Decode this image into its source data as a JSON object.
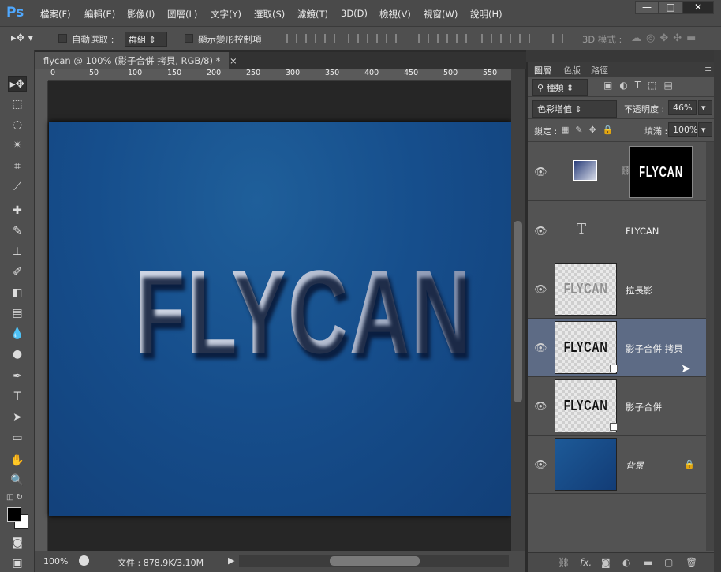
{
  "app": {
    "logo": "Ps"
  },
  "menu": [
    "檔案(F)",
    "編輯(E)",
    "影像(I)",
    "圖層(L)",
    "文字(Y)",
    "選取(S)",
    "濾鏡(T)",
    "3D(D)",
    "檢視(V)",
    "視窗(W)",
    "說明(H)"
  ],
  "window_controls": {
    "minimize": "—",
    "maximize": "□",
    "close": "✕"
  },
  "options": {
    "auto_select_label": "自動選取 :",
    "auto_select_value": "群組",
    "show_transform_label": "顯示變形控制項",
    "mode_3d_label": "3D 模式 :"
  },
  "document": {
    "tab_title": "flycan @ 100% (影子合併 拷貝, RGB/8) *",
    "tab_close": "×",
    "canvas_text": "FLYCAN",
    "ruler_ticks": [
      "0",
      "50",
      "100",
      "150",
      "200",
      "250",
      "300",
      "350",
      "400",
      "450",
      "500",
      "550"
    ]
  },
  "status": {
    "zoom": "100%",
    "doc_info": "文件 : 878.9K/3.10M"
  },
  "layers_panel": {
    "tabs": [
      "圖層",
      "色版",
      "路徑"
    ],
    "filter_kind": "種類",
    "blend_mode": "色彩增值",
    "opacity_label": "不透明度 :",
    "opacity_value": "46%",
    "lock_label": "鎖定 :",
    "fill_label": "填滿 :",
    "fill_value": "100%",
    "layers": [
      {
        "name": "",
        "mask_text": "FLYCAN",
        "type": "adjustment-with-mask"
      },
      {
        "name": "FLYCAN",
        "type": "text",
        "type_glyph": "T"
      },
      {
        "name": "拉長影",
        "thumb_text": "FLYCAN",
        "type": "pixel"
      },
      {
        "name": "影子合併 拷貝",
        "thumb_text": "FLYCAN",
        "type": "smart-object",
        "selected": true
      },
      {
        "name": "影子合併",
        "thumb_text": "FLYCAN",
        "type": "smart-object"
      },
      {
        "name": "背景",
        "type": "background",
        "locked": true
      }
    ]
  },
  "colors": {
    "accent_selected_layer": "#5d6b85",
    "canvas_blue": "#164e8c",
    "ps_logo": "#4fa8ff"
  }
}
